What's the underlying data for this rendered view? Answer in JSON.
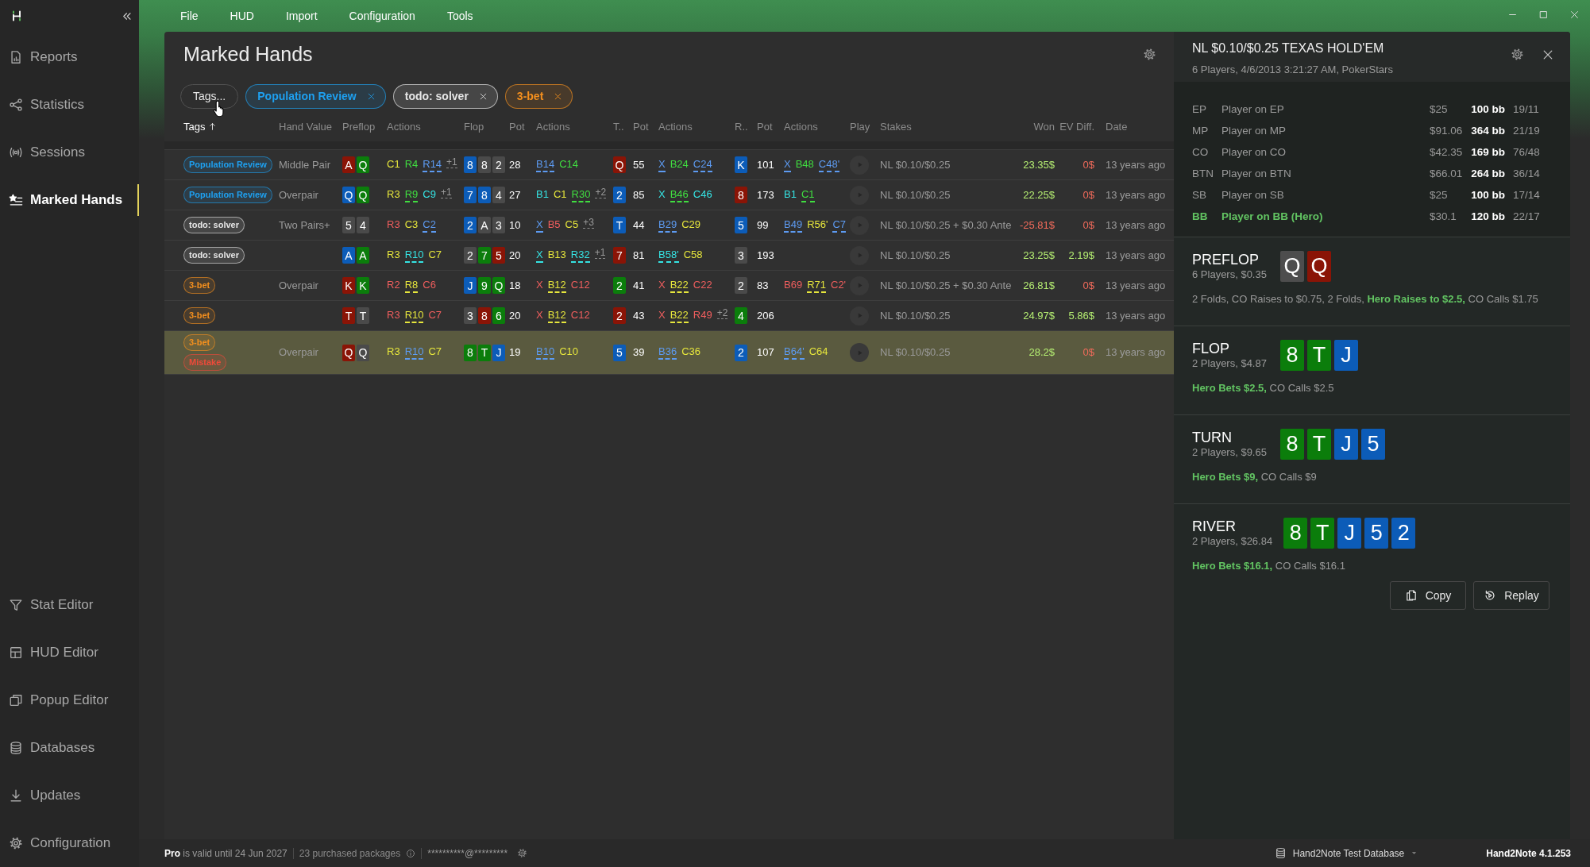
{
  "sidebar": {
    "top_items": [
      {
        "label": "Reports",
        "selected": false
      },
      {
        "label": "Statistics",
        "selected": false
      },
      {
        "label": "Sessions",
        "selected": false
      },
      {
        "label": "Marked Hands",
        "selected": true
      }
    ],
    "bottom_items": [
      {
        "label": "Stat Editor",
        "selected": false
      },
      {
        "label": "HUD Editor",
        "selected": false
      },
      {
        "label": "Popup Editor",
        "selected": false
      },
      {
        "label": "Databases",
        "selected": false
      },
      {
        "label": "Updates",
        "selected": false
      },
      {
        "label": "Configuration",
        "selected": false
      }
    ]
  },
  "menu": [
    "File",
    "HUD",
    "Import",
    "Configuration",
    "Tools"
  ],
  "page": {
    "title": "Marked Hands",
    "filter_button": "Tags...",
    "filters": [
      {
        "label": "Population Review",
        "color": "#1ea0f0"
      },
      {
        "label": "todo: solver",
        "color": "#e6e6e6"
      },
      {
        "label": "3-bet",
        "color": "#f5901e"
      }
    ]
  },
  "table": {
    "columns": [
      {
        "label": "Tags",
        "sorted": true
      },
      {
        "label": "Hand Value",
        "sorted": false
      },
      {
        "label": "Preflop",
        "sorted": false
      },
      {
        "label": "Actions",
        "sorted": false
      },
      {
        "label": "Flop",
        "sorted": false
      },
      {
        "label": "Pot",
        "sorted": false
      },
      {
        "label": "Actions",
        "sorted": false
      },
      {
        "label": "T..",
        "sorted": false
      },
      {
        "label": "Pot",
        "sorted": false
      },
      {
        "label": "Actions",
        "sorted": false
      },
      {
        "label": "R..",
        "sorted": false
      },
      {
        "label": "Pot",
        "sorted": false
      },
      {
        "label": "Actions",
        "sorted": false
      },
      {
        "label": "Play",
        "sorted": false
      },
      {
        "label": "Stakes",
        "sorted": false
      },
      {
        "label": "Won",
        "sorted": false
      },
      {
        "label": "EV Diff.",
        "sorted": false
      },
      {
        "label": "Date",
        "sorted": false
      }
    ],
    "rows": [
      {
        "selected": false,
        "tags": [
          {
            "label": "Population Review",
            "color": "#1ea0f0"
          }
        ],
        "hand_value": "Middle Pair",
        "preflop": {
          "cards": [
            {
              "rank": "A",
              "color": "#8a1406"
            },
            {
              "rank": "Q",
              "color": "#0b7d0b"
            }
          ],
          "actions": [
            {
              "kind": "action",
              "text": "C1",
              "color": "#e6e63c",
              "hero": false
            },
            {
              "kind": "action",
              "text": "R4",
              "color": "#40de40",
              "hero": false
            },
            {
              "kind": "action",
              "text": "R14",
              "color": "#5d9bf2",
              "hero": true
            },
            {
              "kind": "more",
              "text": "+1"
            }
          ]
        },
        "flop": {
          "cards": [
            {
              "rank": "8",
              "color": "#0c5cb8"
            },
            {
              "rank": "8",
              "color": "#4a4a4a"
            },
            {
              "rank": "2",
              "color": "#4a4a4a"
            }
          ],
          "pot": "28",
          "actions": [
            {
              "kind": "action",
              "text": "B14",
              "color": "#5d9bf2",
              "hero": true
            },
            {
              "kind": "action",
              "text": "C14",
              "color": "#40de40",
              "hero": false
            }
          ]
        },
        "turn": {
          "cards": [
            {
              "rank": "Q",
              "color": "#8a1406"
            }
          ],
          "pot": "55",
          "actions": [
            {
              "kind": "action",
              "text": "X",
              "color": "#5d9bf2",
              "hero": true
            },
            {
              "kind": "action",
              "text": "B24",
              "color": "#40de40",
              "hero": false
            },
            {
              "kind": "action",
              "text": "C24",
              "color": "#5d9bf2",
              "hero": true
            }
          ]
        },
        "river": {
          "cards": [
            {
              "rank": "K",
              "color": "#0c5cb8"
            }
          ],
          "pot": "101",
          "actions": [
            {
              "kind": "action",
              "text": "X",
              "color": "#5d9bf2",
              "hero": true
            },
            {
              "kind": "action",
              "text": "B48",
              "color": "#40de40",
              "hero": false
            },
            {
              "kind": "action",
              "text": "C48'",
              "color": "#5d9bf2",
              "hero": true
            }
          ]
        },
        "stakes": "NL $0.10/$0.25",
        "won": {
          "text": "23.35$",
          "kind": "gain"
        },
        "ev_diff": {
          "text": "0$",
          "kind": "loss"
        },
        "date": "13 years ago"
      },
      {
        "selected": false,
        "tags": [
          {
            "label": "Population Review",
            "color": "#1ea0f0"
          }
        ],
        "hand_value": "Overpair",
        "preflop": {
          "cards": [
            {
              "rank": "Q",
              "color": "#0c5cb8"
            },
            {
              "rank": "Q",
              "color": "#0b7d0b"
            }
          ],
          "actions": [
            {
              "kind": "action",
              "text": "R3",
              "color": "#e6e63c",
              "hero": false
            },
            {
              "kind": "action",
              "text": "R9",
              "color": "#40de40",
              "hero": true
            },
            {
              "kind": "action",
              "text": "C9",
              "color": "#35e4e4",
              "hero": false
            },
            {
              "kind": "more",
              "text": "+1"
            }
          ]
        },
        "flop": {
          "cards": [
            {
              "rank": "7",
              "color": "#0c5cb8"
            },
            {
              "rank": "8",
              "color": "#0c5cb8"
            },
            {
              "rank": "4",
              "color": "#4a4a4a"
            }
          ],
          "pot": "27",
          "actions": [
            {
              "kind": "action",
              "text": "B1",
              "color": "#35e4e4",
              "hero": false
            },
            {
              "kind": "action",
              "text": "C1",
              "color": "#e6e63c",
              "hero": false
            },
            {
              "kind": "action",
              "text": "R30",
              "color": "#40de40",
              "hero": true
            },
            {
              "kind": "more",
              "text": "+2"
            }
          ]
        },
        "turn": {
          "cards": [
            {
              "rank": "2",
              "color": "#0c5cb8"
            }
          ],
          "pot": "85",
          "actions": [
            {
              "kind": "action",
              "text": "X",
              "color": "#35e4e4",
              "hero": false
            },
            {
              "kind": "action",
              "text": "B46",
              "color": "#40de40",
              "hero": true
            },
            {
              "kind": "action",
              "text": "C46",
              "color": "#35e4e4",
              "hero": false
            }
          ]
        },
        "river": {
          "cards": [
            {
              "rank": "8",
              "color": "#8a1406"
            }
          ],
          "pot": "173",
          "actions": [
            {
              "kind": "action",
              "text": "B1",
              "color": "#35e4e4",
              "hero": false
            },
            {
              "kind": "action",
              "text": "C1",
              "color": "#40de40",
              "hero": true
            }
          ]
        },
        "stakes": "NL $0.10/$0.25",
        "won": {
          "text": "22.25$",
          "kind": "gain"
        },
        "ev_diff": {
          "text": "0$",
          "kind": "loss"
        },
        "date": "13 years ago"
      },
      {
        "selected": false,
        "tags": [
          {
            "label": "todo: solver",
            "color": "#e6e6e6"
          }
        ],
        "hand_value": "Two Pairs+",
        "preflop": {
          "cards": [
            {
              "rank": "5",
              "color": "#4a4a4a"
            },
            {
              "rank": "4",
              "color": "#4a4a4a"
            }
          ],
          "actions": [
            {
              "kind": "action",
              "text": "R3",
              "color": "#f05e5e",
              "hero": false
            },
            {
              "kind": "action",
              "text": "C3",
              "color": "#e6e63c",
              "hero": false
            },
            {
              "kind": "action",
              "text": "C2",
              "color": "#5d9bf2",
              "hero": true
            }
          ]
        },
        "flop": {
          "cards": [
            {
              "rank": "2",
              "color": "#0c5cb8"
            },
            {
              "rank": "A",
              "color": "#4a4a4a"
            },
            {
              "rank": "3",
              "color": "#4a4a4a"
            }
          ],
          "pot": "10",
          "actions": [
            {
              "kind": "action",
              "text": "X",
              "color": "#5d9bf2",
              "hero": true
            },
            {
              "kind": "action",
              "text": "B5",
              "color": "#f05e5e",
              "hero": false
            },
            {
              "kind": "action",
              "text": "C5",
              "color": "#e6e63c",
              "hero": false
            },
            {
              "kind": "more",
              "text": "+3"
            }
          ]
        },
        "turn": {
          "cards": [
            {
              "rank": "T",
              "color": "#0c5cb8"
            }
          ],
          "pot": "44",
          "actions": [
            {
              "kind": "action",
              "text": "B29",
              "color": "#5d9bf2",
              "hero": true
            },
            {
              "kind": "action",
              "text": "C29",
              "color": "#e6e63c",
              "hero": false
            }
          ]
        },
        "river": {
          "cards": [
            {
              "rank": "5",
              "color": "#0c5cb8"
            }
          ],
          "pot": "99",
          "actions": [
            {
              "kind": "action",
              "text": "B49",
              "color": "#5d9bf2",
              "hero": true
            },
            {
              "kind": "action",
              "text": "R56'",
              "color": "#e6e63c",
              "hero": false
            },
            {
              "kind": "action",
              "text": "C7",
              "color": "#5d9bf2",
              "hero": true
            }
          ]
        },
        "stakes": "NL $0.10/$0.25 + $0.30 Ante",
        "won": {
          "text": "-25.81$",
          "kind": "loss"
        },
        "ev_diff": {
          "text": "0$",
          "kind": "loss"
        },
        "date": "13 years ago"
      },
      {
        "selected": false,
        "tags": [
          {
            "label": "todo: solver",
            "color": "#e6e6e6"
          }
        ],
        "preflop": {
          "cards": [
            {
              "rank": "A",
              "color": "#0c5cb8"
            },
            {
              "rank": "A",
              "color": "#0b7d0b"
            }
          ],
          "actions": [
            {
              "kind": "action",
              "text": "R3",
              "color": "#e6e63c",
              "hero": false
            },
            {
              "kind": "action",
              "text": "R10",
              "color": "#35e4e4",
              "hero": true
            },
            {
              "kind": "action",
              "text": "C7",
              "color": "#e6e63c",
              "hero": false
            }
          ]
        },
        "flop": {
          "cards": [
            {
              "rank": "2",
              "color": "#4a4a4a"
            },
            {
              "rank": "7",
              "color": "#0b7d0b"
            },
            {
              "rank": "5",
              "color": "#8a1406"
            }
          ],
          "pot": "20",
          "actions": [
            {
              "kind": "action",
              "text": "X",
              "color": "#35e4e4",
              "hero": true
            },
            {
              "kind": "action",
              "text": "B13",
              "color": "#e6e63c",
              "hero": false
            },
            {
              "kind": "action",
              "text": "R32",
              "color": "#35e4e4",
              "hero": true
            },
            {
              "kind": "more",
              "text": "+1"
            }
          ]
        },
        "turn": {
          "cards": [
            {
              "rank": "7",
              "color": "#8a1406"
            }
          ],
          "pot": "81",
          "actions": [
            {
              "kind": "action",
              "text": "B58'",
              "color": "#35e4e4",
              "hero": true
            },
            {
              "kind": "action",
              "text": "C58",
              "color": "#e6e63c",
              "hero": false
            }
          ]
        },
        "river": {
          "cards": [
            {
              "rank": "3",
              "color": "#4a4a4a"
            }
          ],
          "pot": "193"
        },
        "stakes": "NL $0.10/$0.25",
        "won": {
          "text": "23.25$",
          "kind": "gain"
        },
        "ev_diff": {
          "text": "2.19$",
          "kind": "gain"
        },
        "date": "13 years ago"
      },
      {
        "selected": false,
        "tags": [
          {
            "label": "3-bet",
            "color": "#f5901e"
          }
        ],
        "hand_value": "Overpair",
        "preflop": {
          "cards": [
            {
              "rank": "K",
              "color": "#8a1406"
            },
            {
              "rank": "K",
              "color": "#0b7d0b"
            }
          ],
          "actions": [
            {
              "kind": "action",
              "text": "R2",
              "color": "#f05e5e",
              "hero": false
            },
            {
              "kind": "action",
              "text": "R8",
              "color": "#e6e63c",
              "hero": true
            },
            {
              "kind": "action",
              "text": "C6",
              "color": "#f05e5e",
              "hero": false
            }
          ]
        },
        "flop": {
          "cards": [
            {
              "rank": "J",
              "color": "#0c5cb8"
            },
            {
              "rank": "9",
              "color": "#0b7d0b"
            },
            {
              "rank": "Q",
              "color": "#0b7d0b"
            }
          ],
          "pot": "18",
          "actions": [
            {
              "kind": "action",
              "text": "X",
              "color": "#f05e5e",
              "hero": false
            },
            {
              "kind": "action",
              "text": "B12",
              "color": "#e6e63c",
              "hero": true
            },
            {
              "kind": "action",
              "text": "C12",
              "color": "#f05e5e",
              "hero": false
            }
          ]
        },
        "turn": {
          "cards": [
            {
              "rank": "2",
              "color": "#0b7d0b"
            }
          ],
          "pot": "41",
          "actions": [
            {
              "kind": "action",
              "text": "X",
              "color": "#f05e5e",
              "hero": false
            },
            {
              "kind": "action",
              "text": "B22",
              "color": "#e6e63c",
              "hero": true
            },
            {
              "kind": "action",
              "text": "C22",
              "color": "#f05e5e",
              "hero": false
            }
          ]
        },
        "river": {
          "cards": [
            {
              "rank": "2",
              "color": "#4a4a4a"
            }
          ],
          "pot": "83",
          "actions": [
            {
              "kind": "action",
              "text": "B69",
              "color": "#f05e5e",
              "hero": false
            },
            {
              "kind": "action",
              "text": "R71",
              "color": "#e6e63c",
              "hero": true
            },
            {
              "kind": "action",
              "text": "C2'",
              "color": "#f05e5e",
              "hero": false
            }
          ]
        },
        "stakes": "NL $0.10/$0.25 + $0.30 Ante",
        "won": {
          "text": "26.81$",
          "kind": "gain"
        },
        "ev_diff": {
          "text": "0$",
          "kind": "loss"
        },
        "date": "13 years ago"
      },
      {
        "selected": false,
        "tags": [
          {
            "label": "3-bet",
            "color": "#f5901e"
          }
        ],
        "preflop": {
          "cards": [
            {
              "rank": "T",
              "color": "#8a1406"
            },
            {
              "rank": "T",
              "color": "#4a4a4a"
            }
          ],
          "actions": [
            {
              "kind": "action",
              "text": "R3",
              "color": "#f05e5e",
              "hero": false
            },
            {
              "kind": "action",
              "text": "R10",
              "color": "#e6e63c",
              "hero": true
            },
            {
              "kind": "action",
              "text": "C7",
              "color": "#f05e5e",
              "hero": false
            }
          ]
        },
        "flop": {
          "cards": [
            {
              "rank": "3",
              "color": "#4a4a4a"
            },
            {
              "rank": "8",
              "color": "#8a1406"
            },
            {
              "rank": "6",
              "color": "#0b7d0b"
            }
          ],
          "pot": "20",
          "actions": [
            {
              "kind": "action",
              "text": "X",
              "color": "#f05e5e",
              "hero": false
            },
            {
              "kind": "action",
              "text": "B12",
              "color": "#e6e63c",
              "hero": true
            },
            {
              "kind": "action",
              "text": "C12",
              "color": "#f05e5e",
              "hero": false
            }
          ]
        },
        "turn": {
          "cards": [
            {
              "rank": "2",
              "color": "#8a1406"
            }
          ],
          "pot": "43",
          "actions": [
            {
              "kind": "action",
              "text": "X",
              "color": "#f05e5e",
              "hero": false
            },
            {
              "kind": "action",
              "text": "B22",
              "color": "#e6e63c",
              "hero": true
            },
            {
              "kind": "action",
              "text": "R49",
              "color": "#f05e5e",
              "hero": false
            },
            {
              "kind": "more",
              "text": "+2"
            }
          ]
        },
        "river": {
          "cards": [
            {
              "rank": "4",
              "color": "#0b7d0b"
            }
          ],
          "pot": "206"
        },
        "stakes": "NL $0.10/$0.25",
        "won": {
          "text": "24.97$",
          "kind": "gain"
        },
        "ev_diff": {
          "text": "5.86$",
          "kind": "gain"
        },
        "date": "13 years ago"
      },
      {
        "selected": true,
        "tags": [
          {
            "label": "3-bet",
            "color": "#f5901e"
          },
          {
            "label": "Mistake",
            "color": "#ee4a3a"
          }
        ],
        "hand_value": "Overpair",
        "preflop": {
          "cards": [
            {
              "rank": "Q",
              "color": "#8a1406"
            },
            {
              "rank": "Q",
              "color": "#4a4a4a"
            }
          ],
          "actions": [
            {
              "kind": "action",
              "text": "R3",
              "color": "#e6e63c",
              "hero": false
            },
            {
              "kind": "action",
              "text": "R10",
              "color": "#5d9bf2",
              "hero": true
            },
            {
              "kind": "action",
              "text": "C7",
              "color": "#e6e63c",
              "hero": false
            }
          ]
        },
        "flop": {
          "cards": [
            {
              "rank": "8",
              "color": "#0b7d0b"
            },
            {
              "rank": "T",
              "color": "#0b7d0b"
            },
            {
              "rank": "J",
              "color": "#0c5cb8"
            }
          ],
          "pot": "19",
          "actions": [
            {
              "kind": "action",
              "text": "B10",
              "color": "#5d9bf2",
              "hero": true
            },
            {
              "kind": "action",
              "text": "C10",
              "color": "#e6e63c",
              "hero": false
            }
          ]
        },
        "turn": {
          "cards": [
            {
              "rank": "5",
              "color": "#0c5cb8"
            }
          ],
          "pot": "39",
          "actions": [
            {
              "kind": "action",
              "text": "B36",
              "color": "#5d9bf2",
              "hero": true
            },
            {
              "kind": "action",
              "text": "C36",
              "color": "#e6e63c",
              "hero": false
            }
          ]
        },
        "river": {
          "cards": [
            {
              "rank": "2",
              "color": "#0c5cb8"
            }
          ],
          "pot": "107",
          "actions": [
            {
              "kind": "action",
              "text": "B64'",
              "color": "#5d9bf2",
              "hero": true
            },
            {
              "kind": "action",
              "text": "C64",
              "color": "#e6e63c",
              "hero": false
            }
          ]
        },
        "stakes": "NL $0.10/$0.25",
        "won": {
          "text": "28.2$",
          "kind": "gain"
        },
        "ev_diff": {
          "text": "0$",
          "kind": "loss"
        },
        "date": "13 years ago"
      }
    ]
  },
  "hand_panel": {
    "title": "NL $0.10/$0.25 TEXAS HOLD'EM",
    "subtitle": "6 Players, 4/6/2013 3:21:27 AM, PokerStars",
    "players": [
      {
        "position": "EP",
        "name": "Player on EP",
        "stack": "$25",
        "bb": "100 bb",
        "stats": "19/11",
        "hero": false
      },
      {
        "position": "MP",
        "name": "Player on MP",
        "stack": "$91.06",
        "bb": "364 bb",
        "stats": "21/19",
        "hero": false
      },
      {
        "position": "CO",
        "name": "Player on CO",
        "stack": "$42.35",
        "bb": "169 bb",
        "stats": "76/48",
        "hero": false
      },
      {
        "position": "BTN",
        "name": "Player on BTN",
        "stack": "$66.01",
        "bb": "264 bb",
        "stats": "36/14",
        "hero": false
      },
      {
        "position": "SB",
        "name": "Player on SB",
        "stack": "$25",
        "bb": "100 bb",
        "stats": "17/14",
        "hero": false
      },
      {
        "position": "BB",
        "name": "Player on BB (Hero)",
        "stack": "$30.1",
        "bb": "120 bb",
        "stats": "22/17",
        "hero": true
      }
    ],
    "streets": [
      {
        "name": "PREFLOP",
        "info": "6 Players, $0.35",
        "cards": [
          {
            "rank": "Q",
            "color": "#4d4d4d"
          },
          {
            "rank": "Q",
            "color": "#8a1406"
          }
        ],
        "actions": "2 Folds, CO Raises to $0.75, 2 Folds, **Hero Raises to $2.5,** CO Calls $1.75"
      },
      {
        "name": "FLOP",
        "info": "2 Players, $4.87",
        "cards": [
          {
            "rank": "8",
            "color": "#0b7d0b"
          },
          {
            "rank": "T",
            "color": "#0b7d0b"
          },
          {
            "rank": "J",
            "color": "#0c5cb8"
          }
        ],
        "actions": "**Hero Bets $2.5,** CO Calls $2.5"
      },
      {
        "name": "TURN",
        "info": "2 Players, $9.65",
        "cards": [
          {
            "rank": "8",
            "color": "#0b7d0b"
          },
          {
            "rank": "T",
            "color": "#0b7d0b"
          },
          {
            "rank": "J",
            "color": "#0c5cb8"
          },
          {
            "rank": "5",
            "color": "#0c5cb8"
          }
        ],
        "actions": "**Hero Bets $9,** CO Calls $9"
      },
      {
        "name": "RIVER",
        "info": "2 Players, $26.84",
        "cards": [
          {
            "rank": "8",
            "color": "#0b7d0b"
          },
          {
            "rank": "T",
            "color": "#0b7d0b"
          },
          {
            "rank": "J",
            "color": "#0c5cb8"
          },
          {
            "rank": "5",
            "color": "#0c5cb8"
          },
          {
            "rank": "2",
            "color": "#0c5cb8"
          }
        ],
        "actions": "**Hero Bets $16.1,** CO Calls $16.1"
      }
    ],
    "buttons": [
      "Copy",
      "Replay"
    ]
  },
  "status_bar": {
    "license": "**Pro** is valid until 24 Jun 2027",
    "packages": "23 purchased packages",
    "account": "**********@*********",
    "database": "Hand2Note Test Database",
    "version": "Hand2Note 4.1.253"
  }
}
